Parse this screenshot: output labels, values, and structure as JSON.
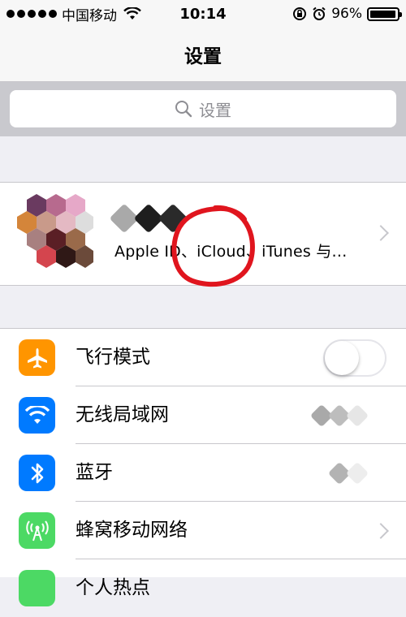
{
  "status_bar": {
    "carrier": "中国移动",
    "time": "10:14",
    "battery": "96%",
    "battery_level": 0.96
  },
  "nav": {
    "title": "设置"
  },
  "search": {
    "placeholder": "设置"
  },
  "profile": {
    "subtitle": "Apple ID、iCloud、iTunes 与…"
  },
  "settings": [
    {
      "label": "飞行模式",
      "icon": "airplane-icon",
      "color": "#ff9500",
      "control": "toggle",
      "on": false
    },
    {
      "label": "无线局域网",
      "icon": "wifi-icon",
      "color": "#007aff",
      "control": "value"
    },
    {
      "label": "蓝牙",
      "icon": "bluetooth-icon",
      "color": "#007aff",
      "control": "value"
    },
    {
      "label": "蜂窝移动网络",
      "icon": "cellular-icon",
      "color": "#4cd964",
      "control": "chevron"
    },
    {
      "label": "个人热点",
      "icon": "hotspot-icon",
      "color": "#4cd964",
      "control": "chevron"
    }
  ],
  "colors": {
    "annotation_circle": "#e0151e",
    "toggle_off_border": "#e5e5ea"
  }
}
